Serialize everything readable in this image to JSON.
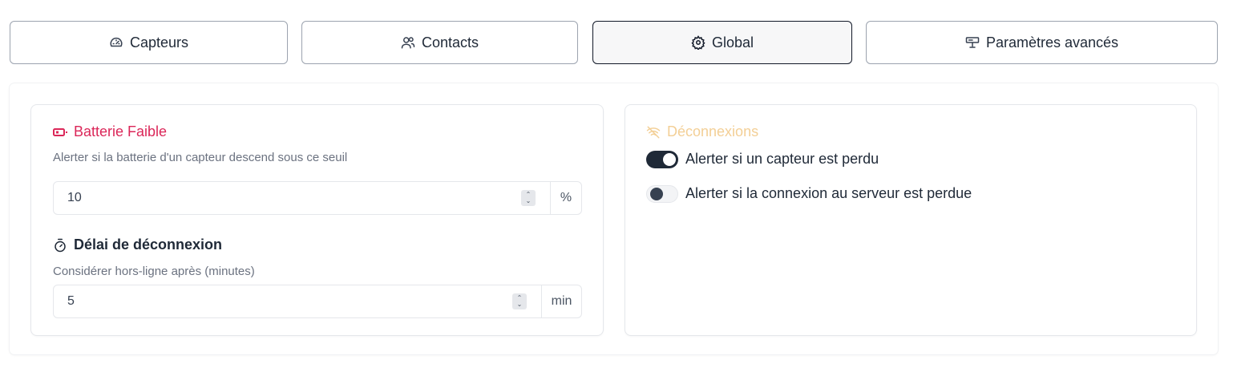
{
  "tabs": [
    {
      "label": "Capteurs",
      "icon": "gauge-icon"
    },
    {
      "label": "Contacts",
      "icon": "users-icon"
    },
    {
      "label": "Global",
      "icon": "gear-icon",
      "active": true
    },
    {
      "label": "Paramètres avancés",
      "icon": "router-icon"
    }
  ],
  "battery": {
    "title": "Batterie Faible",
    "title_color": "#db2759",
    "description": "Alerter si la batterie d'un capteur descend sous ce seuil",
    "value": "10",
    "unit": "%"
  },
  "timeout": {
    "title": "Délai de déconnexion",
    "description": "Considérer hors-ligne après (minutes)",
    "value": "5",
    "unit": "min"
  },
  "disconnections": {
    "title": "Déconnexions",
    "title_color": "#f3cf96",
    "toggles": [
      {
        "label": "Alerter si un capteur est perdu",
        "on": true
      },
      {
        "label": "Alerter si la connexion au serveur est perdue",
        "on": false
      }
    ]
  }
}
